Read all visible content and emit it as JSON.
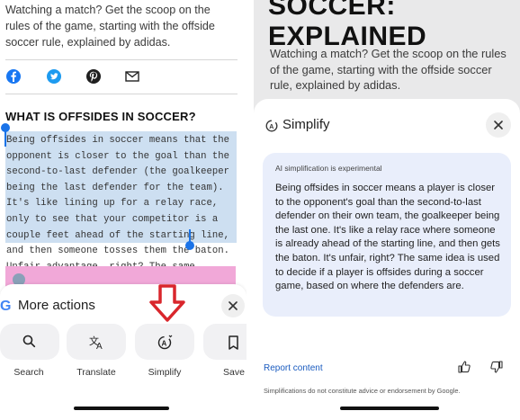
{
  "left_page": {
    "intro": "Watching a match? Get the scoop on the rules of the game, starting with the offside soccer rule, explained by adidas.",
    "share_icons": [
      "facebook-icon",
      "twitter-icon",
      "pinterest-icon",
      "email-icon"
    ],
    "section_title": "WHAT IS OFFSIDES IN SOCCER?",
    "selected_text": "Being offsides in soccer means that the opponent is closer to the goal than the second-to-last defender (the goalkeeper being the last defender for the team). It's like lining up for a relay race, only to see that your competitor is a couple feet ahead of the starting line, and then someone tosses them the baton. Unfair advantage, right? The same principle applies in soccer on the line of defenders."
  },
  "more_actions": {
    "logo": "G",
    "title": "More actions",
    "actions": [
      {
        "label": "Search",
        "icon": "search-icon"
      },
      {
        "label": "Translate",
        "icon": "translate-icon"
      },
      {
        "label": "Simplify",
        "icon": "simplify-icon"
      },
      {
        "label": "Save",
        "icon": "bookmark-icon"
      }
    ]
  },
  "right_page": {
    "title": "SOCCER:\nEXPLAINED",
    "intro": "Watching a match? Get the scoop on the rules of the game, starting with the offside soccer rule, explained by adidas."
  },
  "simplify": {
    "title": "Simplify",
    "experimental_note": "AI simplification is experimental",
    "body": "Being offsides in soccer means a player is closer to the opponent's goal than the second-to-last defender on their own team, the goalkeeper being the last one. It's like a relay race where someone is already ahead of the starting line, and then gets the baton. It's unfair, right? The same idea is used to decide if a player is offsides during a soccer game, based on where the defenders are.",
    "report_label": "Report content",
    "disclaimer": "Simplifications do not constitute advice or endorsement by Google."
  },
  "colors": {
    "selection": "#cddff1",
    "handle": "#1a73e8",
    "arrow": "#d9262c",
    "simplify_box": "#e9eefb",
    "link": "#1a5bbf"
  }
}
